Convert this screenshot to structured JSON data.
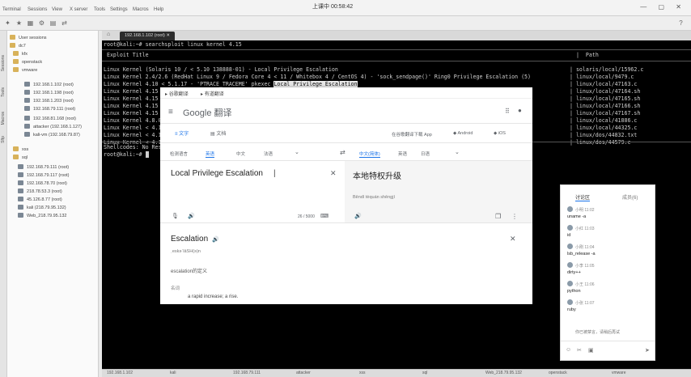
{
  "menu": {
    "items": [
      "Terminal",
      "Sessions",
      "View",
      "X server",
      "Tools",
      "Settings",
      "Macros",
      "Help"
    ],
    "clock": "上课中 00:58:42"
  },
  "sessions": {
    "items": [
      {
        "label": "User sessions"
      },
      {
        "label": "dc7"
      },
      {
        "label": "kfx"
      },
      {
        "label": "openstack"
      },
      {
        "label": "vmware"
      },
      {
        "label": "192.168.1.102 (root)"
      },
      {
        "label": "192.168.1.198 (root)"
      },
      {
        "label": "192.168.1.203 (root)"
      },
      {
        "label": "192.168.79.111 (root)"
      },
      {
        "label": "192.168.81.168 (root)"
      },
      {
        "label": "attacker (192.168.1.127)"
      },
      {
        "label": "kali-vm (192.168.79.87)"
      },
      {
        "label": "xss"
      },
      {
        "label": "sql"
      },
      {
        "label": "192.168.79.111 (root)"
      },
      {
        "label": "192.168.79.117 (root)"
      },
      {
        "label": "192.168.78.70 (root)"
      },
      {
        "label": "218.78.53.3 (root)"
      },
      {
        "label": "45.126.8.77 (root)"
      },
      {
        "label": "kali (218.79.95.132)"
      },
      {
        "label": "Web_218.79.95.132"
      }
    ]
  },
  "terminal": {
    "tab_label": "192.168.1.102 (root)",
    "prompt_cmd": "root@kali:~# searchsploit linux kernel 4.15",
    "header_title": " Exploit Title",
    "header_path": "|  Path",
    "rows": [
      {
        "title": "Linux Kernel (Solaris 10 / < 5.10 138888-01) - Local Privilege Escalation",
        "path": "| solaris/local/15962.c"
      },
      {
        "title": "Linux Kernel 2.4/2.6 (RedHat Linux 9 / Fedora Core 4 < 11 / Whitebox 4 / CentOS 4) - 'sock_sendpage()' Ring0 Privilege Escalation (5)",
        "path": "| linux/local/9479.c"
      },
      {
        "title": "Linux Kernel 4.10 < 5.1.17 - 'PTRACE_TRACEME' pkexec ",
        "highlight": "Local Privilege Escalation",
        "path": "| linux/local/47163.c"
      },
      {
        "title": "Linux Kernel 4.15",
        "path": "| linux/local/47164.sh"
      },
      {
        "title": "Linux Kernel 4.15",
        "path": "| linux/local/47165.sh"
      },
      {
        "title": "Linux Kernel 4.15",
        "path": "| linux/local/47166.sh"
      },
      {
        "title": "Linux Kernel 4.15",
        "path": "| linux/local/47167.sh"
      },
      {
        "title": "Linux Kernel 4.8.0",
        "path": "| linux/local/41886.c"
      },
      {
        "title": "Linux Kernel < 4.1",
        "path": "| linux/local/44325.c"
      },
      {
        "title": "Linux Kernel < 4.1",
        "path": "| linux/dos/44832.txt"
      },
      {
        "title": "Linux Kernel < 4.1",
        "path": "| linux/dos/44579.c"
      }
    ],
    "footer": "Shellcodes: No Res",
    "prompt2": "root@kali:~# "
  },
  "translate": {
    "tab1": "谷歌翻译",
    "tab2": "有道翻译",
    "brand": "Google 翻译",
    "mode_text": "文字",
    "mode_doc": "文档",
    "app_note": "在谷歌翻译下载 App",
    "android": "Android",
    "ios": "iOS",
    "src_langs": [
      "检测语言",
      "英语",
      "中文",
      "法语"
    ],
    "tgt_langs": [
      "中文(简体)",
      "英语",
      "日语"
    ],
    "source_text": "Local Privilege Escalation",
    "target_text": "本地特权升级",
    "romanization": "Běndì tèquán shēngjí",
    "char_count": "26 / 5000",
    "dict_word": "Escalation",
    "dict_phonetic": "ˌeskəˈlāSH(ə)n",
    "dict_cn": "escalation的定义",
    "dict_pos": "名词",
    "dict_def": "a rapid increase; a rise."
  },
  "chat": {
    "tab_active": "讨论区",
    "tab_other": "成员(6)",
    "messages": [
      {
        "user": "小明 11:02",
        "text": "uname -a"
      },
      {
        "user": "小红 11:03",
        "text": "id"
      },
      {
        "user": "小刚 11:04",
        "text": "lsb_release -a"
      },
      {
        "user": "小李 11:05",
        "text": "dirty++"
      },
      {
        "user": "小王 11:06",
        "text": "python"
      },
      {
        "user": "小张 11:07",
        "text": "ruby"
      }
    ],
    "notice": "你已被禁言，请稍后再试",
    "input_placeholder": ""
  },
  "taskbar": {
    "items": [
      "192.168.1.102",
      "kali",
      "192.168.79.111",
      "attacker",
      "xss",
      "sql",
      "Web_218.79.95.132",
      "openstack",
      "vmware"
    ]
  }
}
